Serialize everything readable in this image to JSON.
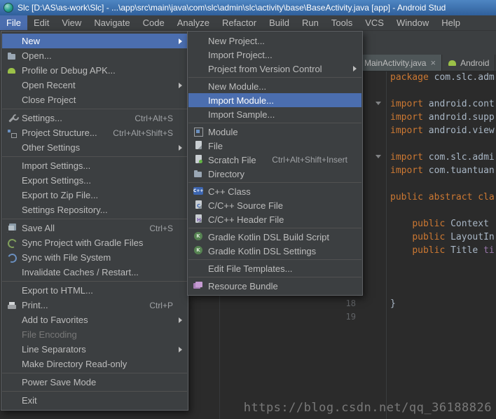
{
  "title_bar": {
    "title": "Slc [D:\\AS\\as-work\\Slc] - ...\\app\\src\\main\\java\\com\\slc\\admin\\slc\\activity\\base\\BaseActivity.java [app] - Android Stud"
  },
  "menu_bar": {
    "items": [
      {
        "label": "File",
        "active": true
      },
      {
        "label": "Edit"
      },
      {
        "label": "View"
      },
      {
        "label": "Navigate"
      },
      {
        "label": "Code"
      },
      {
        "label": "Analyze"
      },
      {
        "label": "Refactor"
      },
      {
        "label": "Build"
      },
      {
        "label": "Run"
      },
      {
        "label": "Tools"
      },
      {
        "label": "VCS"
      },
      {
        "label": "Window"
      },
      {
        "label": "Help"
      }
    ]
  },
  "file_menu": {
    "items": [
      {
        "label": "New",
        "submenu": true,
        "highlighted": true
      },
      {
        "label": "Open...",
        "icon": "open-folder"
      },
      {
        "label": "Profile or Debug APK...",
        "icon": "android"
      },
      {
        "label": "Open Recent",
        "submenu": true
      },
      {
        "label": "Close Project"
      },
      {
        "type": "separator"
      },
      {
        "label": "Settings...",
        "shortcut": "Ctrl+Alt+S",
        "icon": "settings-wrench"
      },
      {
        "label": "Project Structure...",
        "shortcut": "Ctrl+Alt+Shift+S",
        "icon": "project-structure"
      },
      {
        "label": "Other Settings",
        "submenu": true
      },
      {
        "type": "separator"
      },
      {
        "label": "Import Settings..."
      },
      {
        "label": "Export Settings..."
      },
      {
        "label": "Export to Zip File..."
      },
      {
        "label": "Settings Repository..."
      },
      {
        "type": "separator"
      },
      {
        "label": "Save All",
        "shortcut": "Ctrl+S",
        "icon": "save-all"
      },
      {
        "label": "Sync Project with Gradle Files",
        "icon": "gradle-sync"
      },
      {
        "label": "Sync with File System",
        "icon": "file-sync"
      },
      {
        "label": "Invalidate Caches / Restart..."
      },
      {
        "type": "separator"
      },
      {
        "label": "Export to HTML..."
      },
      {
        "label": "Print...",
        "shortcut": "Ctrl+P",
        "icon": "printer"
      },
      {
        "label": "Add to Favorites",
        "submenu": true
      },
      {
        "label": "File Encoding",
        "disabled": true
      },
      {
        "label": "Line Separators",
        "submenu": true
      },
      {
        "label": "Make Directory Read-only"
      },
      {
        "type": "separator"
      },
      {
        "label": "Power Save Mode"
      },
      {
        "type": "separator"
      },
      {
        "label": "Exit"
      }
    ]
  },
  "new_submenu": {
    "items": [
      {
        "label": "New Project..."
      },
      {
        "label": "Import Project..."
      },
      {
        "label": "Project from Version Control",
        "submenu": true
      },
      {
        "type": "separator"
      },
      {
        "label": "New Module..."
      },
      {
        "label": "Import Module...",
        "highlighted": true
      },
      {
        "label": "Import Sample..."
      },
      {
        "type": "separator"
      },
      {
        "label": "Module",
        "icon": "module"
      },
      {
        "label": "File",
        "icon": "file"
      },
      {
        "label": "Scratch File",
        "shortcut": "Ctrl+Alt+Shift+Insert",
        "icon": "scratch-file"
      },
      {
        "label": "Directory",
        "icon": "directory"
      },
      {
        "type": "separator"
      },
      {
        "label": "C++ Class",
        "icon": "cpp-class"
      },
      {
        "label": "C/C++ Source File",
        "icon": "cpp-source"
      },
      {
        "label": "C/C++ Header File",
        "icon": "cpp-header"
      },
      {
        "type": "separator"
      },
      {
        "label": "Gradle Kotlin DSL Build Script",
        "icon": "gradle-kotlin"
      },
      {
        "label": "Gradle Kotlin DSL Settings",
        "icon": "gradle-kotlin-settings"
      },
      {
        "type": "separator"
      },
      {
        "label": "Edit File Templates..."
      },
      {
        "type": "separator"
      },
      {
        "label": "Resource Bundle",
        "icon": "resource-bundle"
      }
    ]
  },
  "editor": {
    "tabs": [
      {
        "label": "MainActivity.java",
        "close_label": "×",
        "selected": true
      },
      {
        "label": "Android",
        "icon": "android"
      }
    ],
    "line_numbers": [
      "18",
      "19"
    ],
    "watermark": "https://blog.csdn.net/qq_36188826",
    "code": {
      "colors": {
        "kw": "#cc7832",
        "pl": "#a9b7c6",
        "fld": "#9876aa"
      },
      "lines": [
        {
          "tokens": [
            [
              "kw",
              "package "
            ],
            [
              "pl",
              "com.slc.adm"
            ]
          ]
        },
        {
          "tokens": []
        },
        {
          "tokens": [
            [
              "kw",
              "import "
            ],
            [
              "pl",
              "android.cont"
            ]
          ]
        },
        {
          "tokens": [
            [
              "kw",
              "import "
            ],
            [
              "pl",
              "android.supp"
            ]
          ]
        },
        {
          "tokens": [
            [
              "kw",
              "import "
            ],
            [
              "pl",
              "android.view"
            ]
          ]
        },
        {
          "tokens": []
        },
        {
          "tokens": [
            [
              "kw",
              "import "
            ],
            [
              "pl",
              "com.slc.admi"
            ]
          ]
        },
        {
          "tokens": [
            [
              "kw",
              "import "
            ],
            [
              "pl",
              "com.tuantuan"
            ]
          ]
        },
        {
          "tokens": []
        },
        {
          "tokens": [
            [
              "kw",
              "public abstract cla"
            ]
          ]
        },
        {
          "tokens": []
        },
        {
          "tokens": [
            [
              "pl",
              "    "
            ],
            [
              "kw",
              "public "
            ],
            [
              "pl",
              "Context "
            ]
          ]
        },
        {
          "tokens": [
            [
              "pl",
              "    "
            ],
            [
              "kw",
              "public "
            ],
            [
              "pl",
              "LayoutIn"
            ]
          ]
        },
        {
          "tokens": [
            [
              "pl",
              "    "
            ],
            [
              "kw",
              "public "
            ],
            [
              "pl",
              "Title "
            ],
            [
              "fld",
              "ti"
            ]
          ]
        },
        {
          "tokens": []
        },
        {
          "tokens": []
        },
        {
          "tokens": []
        },
        {
          "tokens": [
            [
              "pl",
              "}"
            ]
          ]
        },
        {
          "tokens": []
        }
      ]
    }
  },
  "colors": {
    "menu_highlight": "#4b6eaf",
    "menu_bg": "#3c3f41",
    "editor_bg": "#2b2b2b",
    "keyword_orange": "#cc7832",
    "titlebar_blue": "#30609b",
    "android_green": "#9bc148"
  }
}
